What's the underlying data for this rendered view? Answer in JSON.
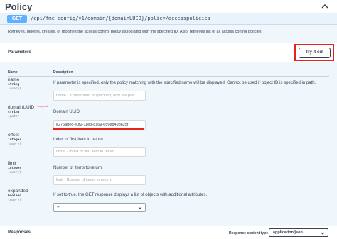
{
  "section": {
    "title": "Policy"
  },
  "operation": {
    "method": "GET",
    "path": "/api/fmc_config/v1/domain/{domainUUID}/policy/accesspolicies",
    "description": "Retrieves, deletes, creates, or modifies the access control policy associated with the specified ID. Also, retrieves list of all access control policies."
  },
  "parameters_panel": {
    "label": "Parameters",
    "try_it_out_label": "Try it out",
    "column_name": "Name",
    "column_description": "Description"
  },
  "parameters": [
    {
      "name": "name",
      "type": "string",
      "in": "(query)",
      "description": "If parameter is specified, only the policy matching with the specified name will be displayed. Cannot be used if object ID is specified in path.",
      "placeholder": "name - If parameter is specified, only the poli"
    },
    {
      "name": "domainUUID",
      "required_marker": "* required",
      "type": "string",
      "in": "(path)",
      "description": "Domain UUID",
      "value": "e276abec-e0f2-11e3-8169-6d9ed49b625f"
    },
    {
      "name": "offset",
      "type": "integer",
      "in": "(query)",
      "description": "Index of first item to return.",
      "placeholder": "offset - Index of first item to return."
    },
    {
      "name": "limit",
      "type": "integer",
      "in": "(query)",
      "description": "Number of items to return.",
      "placeholder": "limit - Number of items to return."
    },
    {
      "name": "expanded",
      "type": "boolean",
      "in": "(query)",
      "description": "If set to true, the GET response displays a list of objects with additional attributes.",
      "selected": "--"
    }
  ],
  "responses": {
    "label": "Responses",
    "content_type_label": "Response content type",
    "content_type_value": "application/json"
  },
  "colors": {
    "get_method": "#61affe",
    "highlight": "#e8211c",
    "operation_bg": "#eff6fc"
  },
  "icons": {
    "collapse": "chevron-up-icon",
    "select_arrow": "chevron-down-icon"
  }
}
